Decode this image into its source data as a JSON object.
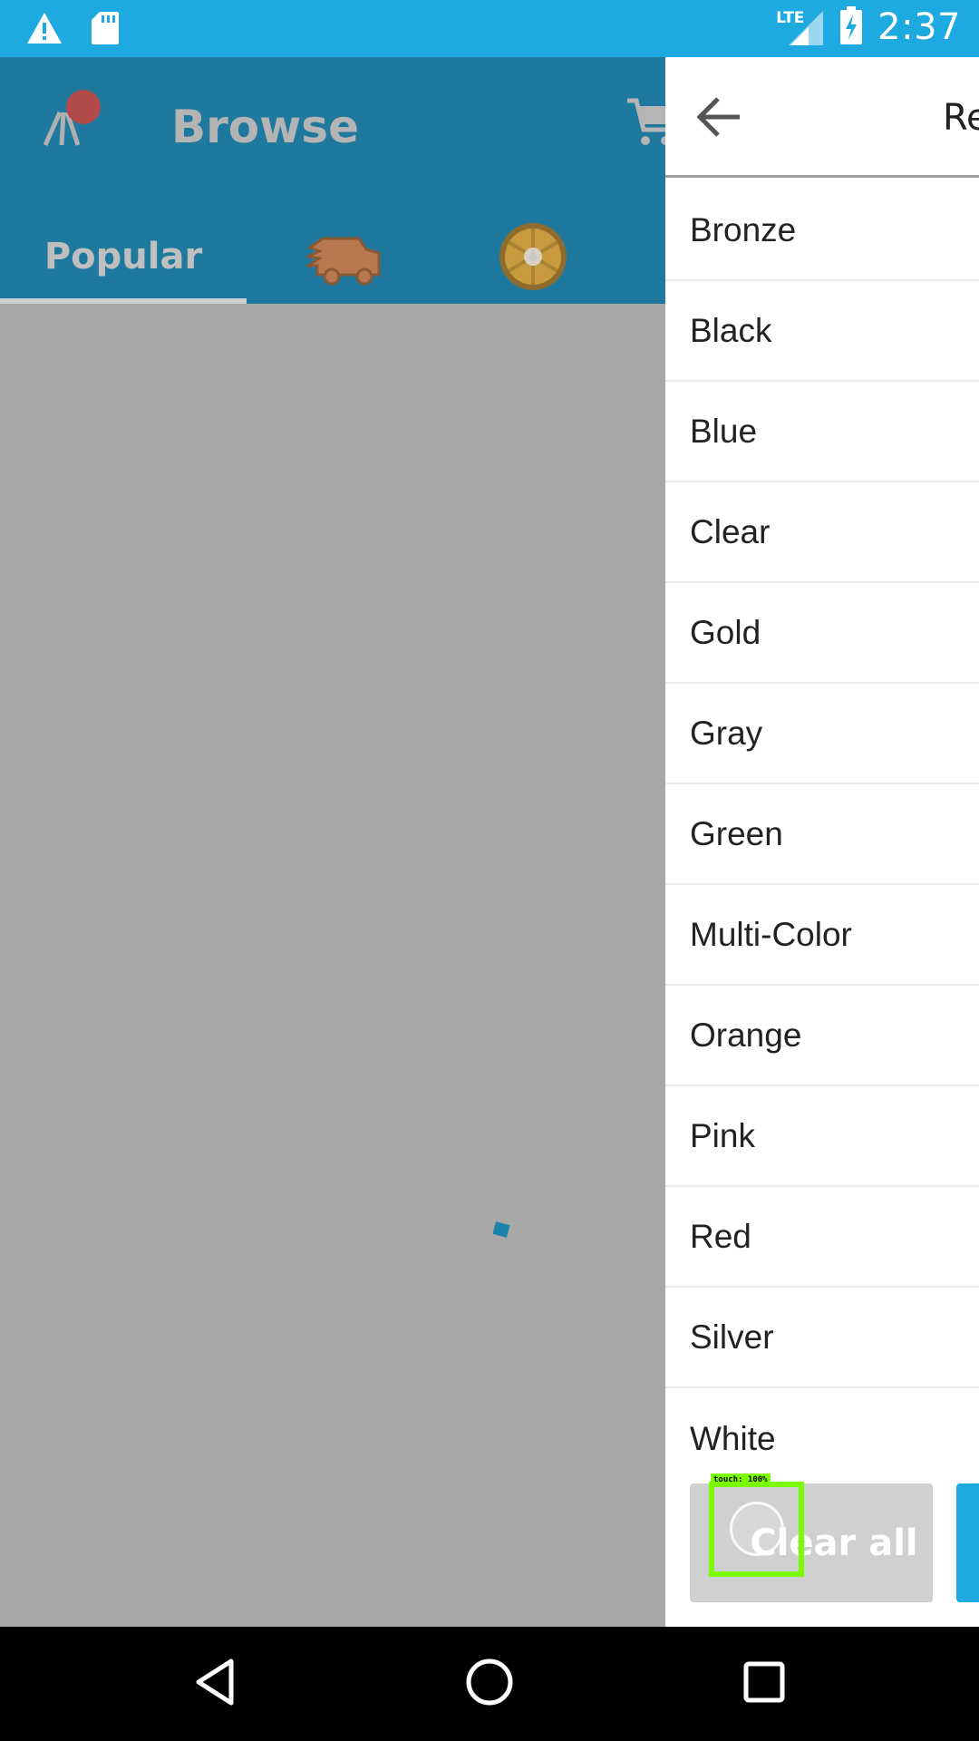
{
  "status_bar": {
    "time": "2:37",
    "network": "LTE",
    "icons": [
      "warning-icon",
      "sd-card-icon",
      "signal-icon",
      "battery-charging-icon"
    ]
  },
  "header": {
    "title": "Browse",
    "icons": [
      "app-logo-icon",
      "cart-icon"
    ]
  },
  "tabs": {
    "popular_label": "Popular",
    "icons": [
      "delivery-truck-icon",
      "wheel-icon"
    ]
  },
  "drawer": {
    "title": "Re",
    "options": [
      "Bronze",
      "Black",
      "Blue",
      "Clear",
      "Gold",
      "Gray",
      "Green",
      "Multi-Color",
      "Orange",
      "Pink",
      "Red",
      "Silver",
      "White"
    ],
    "clear_label": "Clear all"
  },
  "touch_indicator": {
    "label": "touch: 100%"
  },
  "nav_bar": {
    "icons": [
      "back-triangle-icon",
      "home-circle-icon",
      "recents-square-icon"
    ]
  },
  "colors": {
    "status_bar": "#1fa9e1",
    "header_dimmed": "#1f799e",
    "scrim": "#a8a8a8",
    "accent": "#1fa9e1",
    "touch": "#7cfc00"
  }
}
